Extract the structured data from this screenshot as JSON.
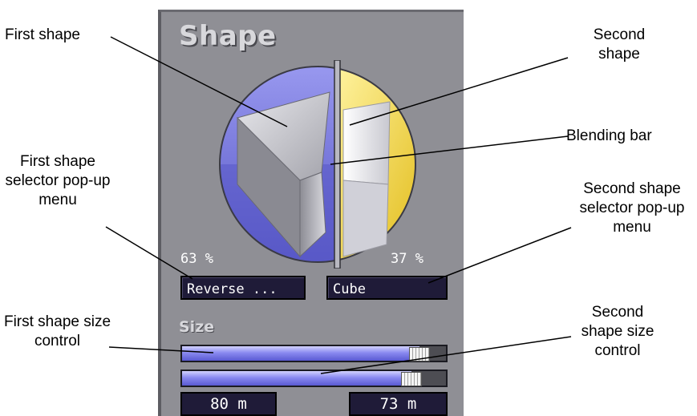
{
  "panel": {
    "title": "Shape",
    "first_shape_percent": "63 %",
    "second_shape_percent": "37 %",
    "first_shape_selector": "Reverse ...",
    "second_shape_selector": "Cube",
    "size_label": "Size",
    "first_size_value": "80 m",
    "second_size_value": "73 m",
    "first_size_slider_level": 0.9,
    "second_size_slider_level": 0.87,
    "blend_ratio": 0.63
  },
  "callouts": {
    "first_shape": "First shape",
    "second_shape": "Second shape",
    "blending_bar": "Blending bar",
    "first_selector": "First shape selector pop-up menu",
    "second_selector": "Second shape selector pop-up menu",
    "first_size": "First shape size control",
    "second_size": "Second shape size control"
  },
  "colors": {
    "panel": "#8f8f95",
    "first_shape_area": "#6b6bd6",
    "second_shape_area": "#f2d230",
    "slider_fill": "#8a8af0",
    "field_bg": "#1f1b38"
  },
  "icons": {
    "first_shape": "wedge-shape-icon",
    "second_shape": "cube-shape-icon"
  }
}
